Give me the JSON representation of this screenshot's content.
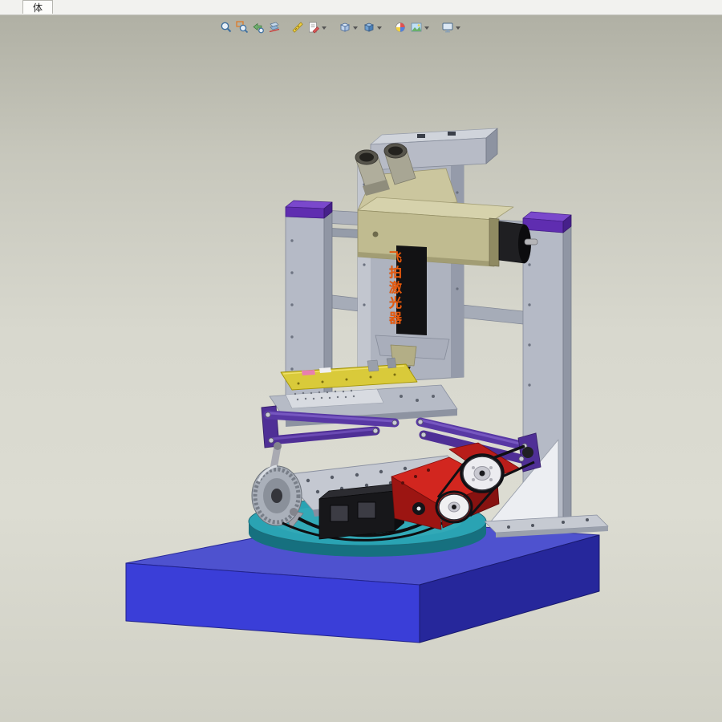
{
  "window": {
    "document_tab": "体"
  },
  "toolbar": {
    "icons": [
      {
        "name": "zoom-to-fit"
      },
      {
        "name": "zoom-to-area"
      },
      {
        "name": "previous-view"
      },
      {
        "name": "section-view"
      },
      {
        "name": "measure"
      },
      {
        "name": "annotation",
        "has_dropdown": true
      },
      {
        "name": "view-orientation",
        "has_dropdown": true
      },
      {
        "name": "display-style",
        "has_dropdown": true
      },
      {
        "name": "edit-appearance",
        "has_dropdown": false
      },
      {
        "name": "apply-scene",
        "has_dropdown": true
      },
      {
        "name": "view-settings",
        "has_dropdown": true
      }
    ]
  },
  "viewport": {
    "model_label_vertical": "飞拍激光器",
    "colors": {
      "base": "#3a3ed8",
      "turntable": "#2aa3b3",
      "frame": "#b5bac6",
      "column_caps": "#5f2db0",
      "linkages": "#5636a0",
      "microscope": "#c0bb90",
      "motor": "#d2261f",
      "fixture_plate": "#d9ca3a",
      "label_text": "#e8590c"
    }
  }
}
